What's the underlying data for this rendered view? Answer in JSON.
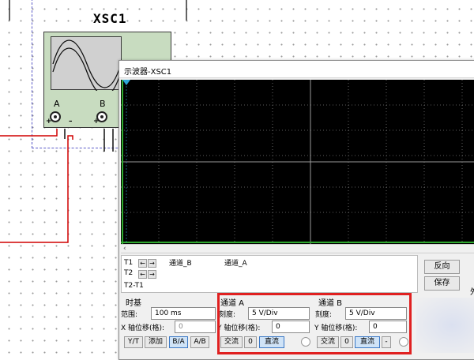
{
  "schematic": {
    "instrument_label": "XSC1",
    "channel_a_label": "A",
    "channel_b_label": "B",
    "polarity_plus": "+",
    "polarity_minus": "–",
    "wire_color": "#d00000",
    "dashed_border_color": "#5a5ac8"
  },
  "oscilloscope": {
    "title": "示波器-XSC1",
    "display_bg": "#000000",
    "grid_color": "#7a7a7a",
    "trace_color": "#2ea82e",
    "scroll_left_icon": "‹",
    "cursor_readout": {
      "t1_label": "T1",
      "t2_label": "T2",
      "t2_t1_label": "T2-T1",
      "left_arrow": "←",
      "right_arrow": "→",
      "columns": [
        "通道_B",
        "通道_A"
      ]
    },
    "reverse_label": "反向",
    "save_label": "保存",
    "external_label": "外",
    "timebase": {
      "title": "时基",
      "range_label": "范围:",
      "range_value": "100 ms",
      "xpos_label": "X 轴位移(格):",
      "xpos_value": "0",
      "buttons": [
        "Y/T",
        "添加",
        "B/A",
        "A/B"
      ],
      "active_button": "B/A"
    },
    "channel_a": {
      "title": "通道 A",
      "scale_label": "刻度:",
      "scale_value": "5  V/Div",
      "ypos_label": "Y 轴位移(格):",
      "ypos_value": "0",
      "ac_label": "交流",
      "zero_label": "0",
      "dc_label": "直流",
      "active": "dc"
    },
    "channel_b": {
      "title": "通道 B",
      "scale_label": "刻度:",
      "scale_value": "5  V/Div",
      "ypos_label": "Y 轴位移(格):",
      "ypos_value": "0",
      "ac_label": "交流",
      "zero_label": "0",
      "dc_label": "直流",
      "minus_label": "-",
      "active": "dc"
    },
    "highlight_color": "#e02020"
  }
}
